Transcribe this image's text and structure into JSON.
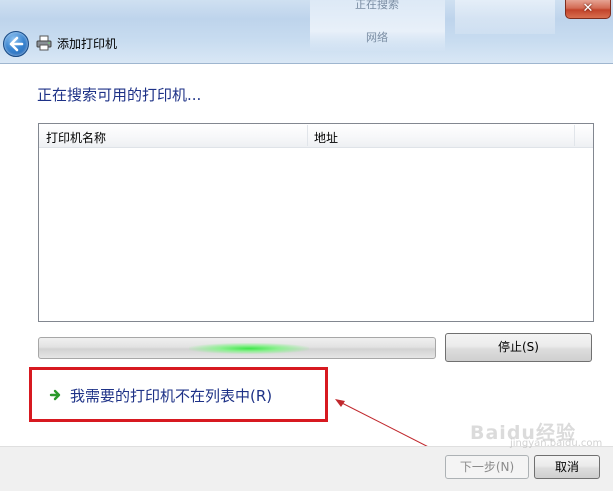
{
  "window": {
    "title": "添加打印机",
    "close_label": "✕",
    "bg_text_1": "正在搜索",
    "bg_text_2": "网络"
  },
  "main": {
    "heading": "正在搜索可用的打印机...",
    "list": {
      "columns": [
        "打印机名称",
        "地址"
      ],
      "rows": []
    },
    "progress": {
      "state": "indeterminate",
      "color": "#3ee54a"
    },
    "stop_label": "停止(S)",
    "not_listed_link": "我需要的打印机不在列表中(R)",
    "highlight_color": "#d71920"
  },
  "footer": {
    "next_label": "下一步(N)",
    "cancel_label": "取消"
  },
  "watermark": {
    "text": "Baidu经验",
    "sub": "jingyan.baidu.com"
  }
}
